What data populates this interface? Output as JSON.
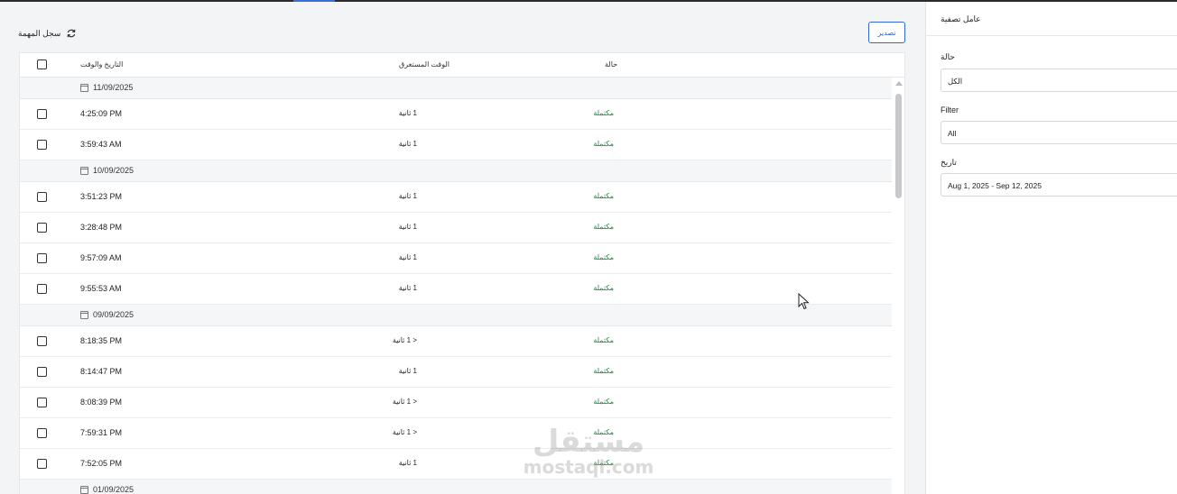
{
  "header": {
    "title": "سجل المهمة",
    "refresh_icon": "refresh-icon",
    "export_label": "تصدير"
  },
  "table": {
    "columns": {
      "datetime": "التاريخ والوقت",
      "duration": "الوقت المستغرق",
      "status": "حالة"
    },
    "groups": [
      {
        "date": "11/09/2025",
        "rows": [
          {
            "time": "4:25:09 PM",
            "duration": "1 ثانية",
            "status": "مكتملة"
          },
          {
            "time": "3:59:43 AM",
            "duration": "1 ثانية",
            "status": "مكتملة"
          }
        ]
      },
      {
        "date": "10/09/2025",
        "rows": [
          {
            "time": "3:51:23 PM",
            "duration": "1 ثانية",
            "status": "مكتملة"
          },
          {
            "time": "3:28:48 PM",
            "duration": "1 ثانية",
            "status": "مكتملة"
          },
          {
            "time": "9:57:09 AM",
            "duration": "1 ثانية",
            "status": "مكتملة"
          },
          {
            "time": "9:55:53 AM",
            "duration": "1 ثانية",
            "status": "مكتملة"
          }
        ]
      },
      {
        "date": "09/09/2025",
        "rows": [
          {
            "time": "8:18:35 PM",
            "duration": "< 1 ثانية",
            "status": "مكتملة"
          },
          {
            "time": "8:14:47 PM",
            "duration": "1 ثانية",
            "status": "مكتملة"
          },
          {
            "time": "8:08:39 PM",
            "duration": "< 1 ثانية",
            "status": "مكتملة"
          },
          {
            "time": "7:59:31 PM",
            "duration": "< 1 ثانية",
            "status": "مكتملة"
          },
          {
            "time": "7:52:05 PM",
            "duration": "1 ثانية",
            "status": "مكتملة"
          }
        ]
      },
      {
        "date": "01/09/2025",
        "rows": []
      }
    ]
  },
  "filters": {
    "title": "عامل تصفية",
    "status_label": "حالة",
    "status_value": "الكل",
    "filter_label": "Filter",
    "filter_value": "All",
    "date_label": "تاريخ",
    "date_value": "Aug 1, 2025 - Sep 12, 2025"
  },
  "colors": {
    "accent": "#2f66cf",
    "status_completed": "#1a7f37"
  },
  "watermark": {
    "arabic": "مستقل",
    "latin": "mostaql.com"
  }
}
